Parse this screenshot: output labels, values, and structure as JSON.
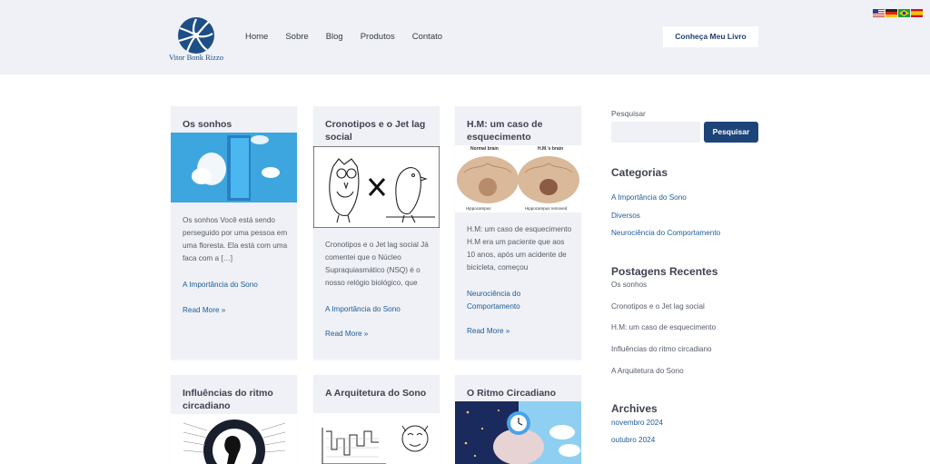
{
  "site": {
    "logo_text": "Vitor Bonk Rizzo",
    "nav": [
      "Home",
      "Sobre",
      "Blog",
      "Produtos",
      "Contato"
    ],
    "cta_label": "Conheça Meu Livro",
    "flags": [
      "us-flag-icon",
      "de-flag-icon",
      "br-flag-icon",
      "es-flag-icon"
    ]
  },
  "posts": [
    {
      "title": "Os sonhos",
      "excerpt": "Os sonhos   Você está sendo perseguido por uma pessoa em uma floresta. Ela está com uma faca com a […]",
      "category": "A Importância do Sono",
      "read_more": "Read More »"
    },
    {
      "title": "Cronotipos e o Jet lag social",
      "excerpt": "Cronotipos e o Jet lag social   Já comentei que o Núcleo Supraquiasmático (NSQ) é o nosso relógio biológico, que",
      "category": "A Importância do Sono",
      "read_more": "Read More »"
    },
    {
      "title": "H.M: um caso de esquecimento",
      "excerpt": "H.M: um caso de esquecimento   H.M era um paciente que aos 10 anos, após um acidente de bicicleta, começou",
      "category": "Neurociência do Comportamento",
      "read_more": "Read More »",
      "image_labels": [
        "Normal brain",
        "H.M.'s brain",
        "Hippocampus",
        "Hippocampus removed"
      ]
    },
    {
      "title": "Influências do ritmo circadiano"
    },
    {
      "title": "A Arquitetura do Sono"
    },
    {
      "title": "O Ritmo Circadiano"
    }
  ],
  "sidebar": {
    "search_label": "Pesquisar",
    "search_placeholder": "",
    "search_button": "Pesquisar",
    "categories_heading": "Categorias",
    "categories": [
      "A Importância do Sono",
      "Diversos",
      "Neurociência do Comportamento"
    ],
    "recent_heading": "Postagens Recentes",
    "recent": [
      "Os sonhos",
      "Cronotipos e o Jet lag social",
      "H.M: um caso de esquecimento",
      "Influências do ritmo circadiano",
      "A Arquitetura do Sono"
    ],
    "archives_heading": "Archives",
    "archives": [
      "novembro 2024",
      "outubro 2024"
    ]
  },
  "colors": {
    "brand": "#1d4478",
    "link": "#1e5c96",
    "header_bg": "#eff1f6",
    "card_bg": "#eff1f6"
  }
}
